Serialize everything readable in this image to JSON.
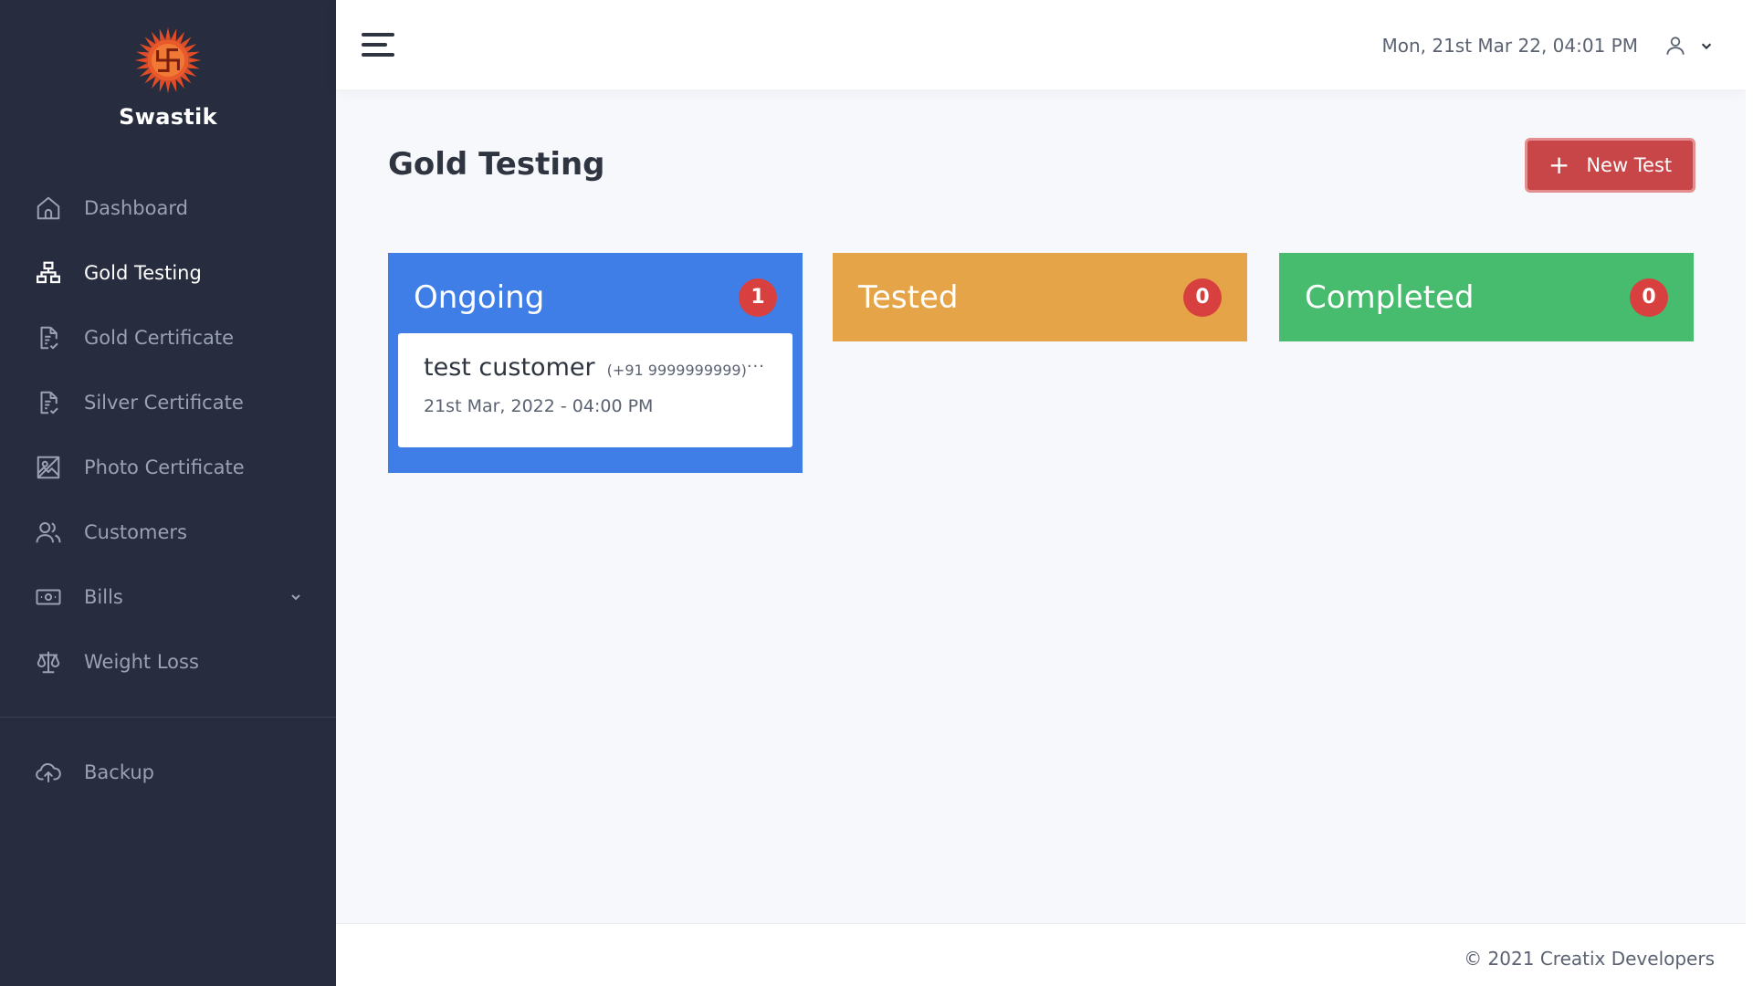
{
  "brand": {
    "name": "Swastik",
    "logo_icon": "sun-swastika-logo",
    "logo_color": "#e14b26"
  },
  "sidebar": {
    "items": [
      {
        "label": "Dashboard",
        "icon": "home-icon",
        "active": false
      },
      {
        "label": "Gold Testing",
        "icon": "sitemap-icon",
        "active": true
      },
      {
        "label": "Gold Certificate",
        "icon": "certificate-icon",
        "active": false
      },
      {
        "label": "Silver Certificate",
        "icon": "certificate-icon",
        "active": false
      },
      {
        "label": "Photo Certificate",
        "icon": "image-icon",
        "active": false
      },
      {
        "label": "Customers",
        "icon": "users-icon",
        "active": false
      },
      {
        "label": "Bills",
        "icon": "banknote-icon",
        "active": false,
        "has_submenu": true
      },
      {
        "label": "Weight Loss",
        "icon": "scale-icon",
        "active": false
      }
    ],
    "backup": {
      "label": "Backup",
      "icon": "cloud-upload-icon"
    }
  },
  "topbar": {
    "datetime": "Mon, 21st Mar 22, 04:01 PM",
    "user_icon": "user-icon",
    "menu_icon": "hamburger-icon"
  },
  "main": {
    "title": "Gold Testing",
    "new_test_button": {
      "plus": "+",
      "label": "New Test"
    },
    "lanes": [
      {
        "title": "Ongoing",
        "count": "1",
        "color": "#3f7ee6",
        "cards": [
          {
            "customer": "test customer",
            "phone": "(+91 9999999999)",
            "more": "···",
            "date": "21st Mar, 2022 - 04:00 PM"
          }
        ]
      },
      {
        "title": "Tested",
        "count": "0",
        "color": "#e6a449",
        "cards": []
      },
      {
        "title": "Completed",
        "count": "0",
        "color": "#48bc6e",
        "cards": []
      }
    ]
  },
  "footer": {
    "text": "© 2021 Creatix Developers"
  }
}
